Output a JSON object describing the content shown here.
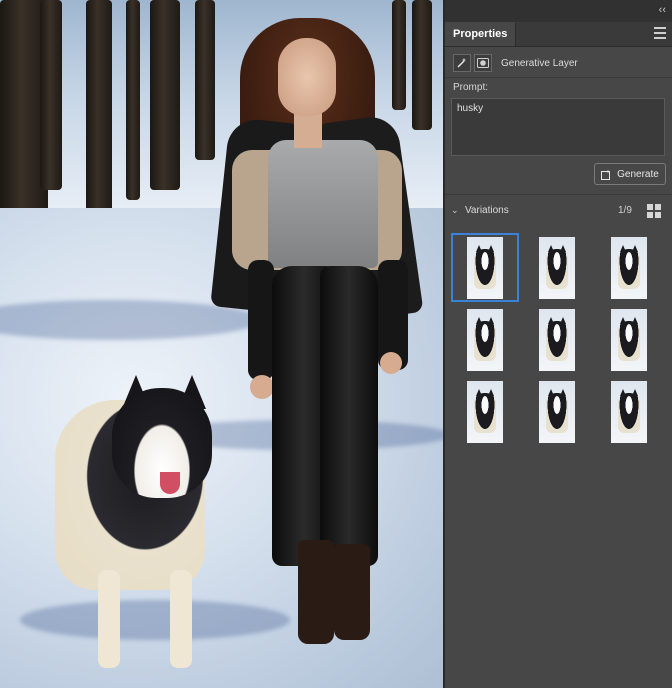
{
  "panel": {
    "collapse_glyph": "‹‹",
    "tab_label": "Properties",
    "layer_type_label": "Generative Layer",
    "prompt_label": "Prompt:",
    "prompt_value": "husky",
    "generate_label": "Generate",
    "variations_label": "Variations",
    "variations_count": "1/9",
    "selected_variation": 1,
    "accent_color": "#3b82d6"
  },
  "icons": [
    "collapse-icon",
    "panel-menu-icon",
    "generative-fill-icon",
    "mask-icon",
    "generate-icon",
    "chevron-down-icon",
    "grid-view-icon"
  ]
}
